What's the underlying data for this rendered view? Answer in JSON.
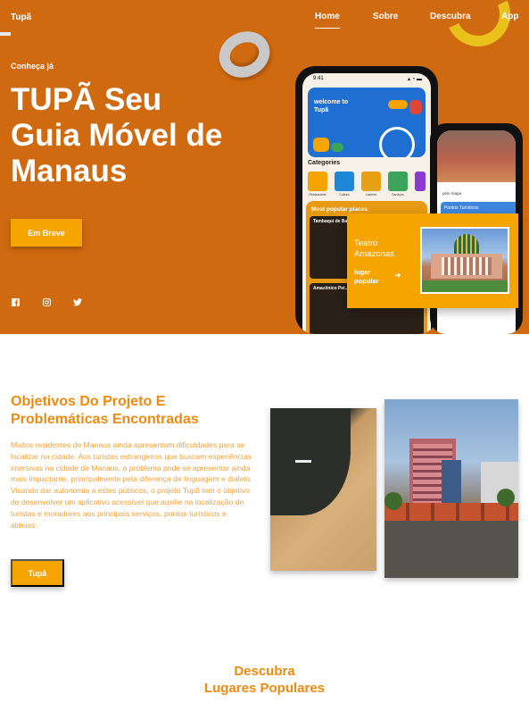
{
  "header": {
    "logo": "Tupã",
    "nav": [
      {
        "label": "Home",
        "active": true
      },
      {
        "label": "Sobre",
        "active": false
      },
      {
        "label": "Descubra",
        "active": false
      },
      {
        "label": "App",
        "active": false
      }
    ]
  },
  "hero": {
    "eyebrow": "Conheça já",
    "title_line1": "TUPÃ Seu",
    "title_line2_regular": "Guia Móvel ",
    "title_line2_bold": "de",
    "title_line3": "Manaus",
    "cta_label": "Em Breve",
    "social_icons": [
      "facebook-icon",
      "instagram-icon",
      "twitter-icon"
    ],
    "background_color": "#d06a10"
  },
  "phone_main": {
    "welcome": "welcome to\nTupã",
    "categories_title": "Categories",
    "categories": [
      "Restaurante",
      "Cultura",
      "Lazeres",
      "Serviços"
    ],
    "popular_title": "Most popular places",
    "places": [
      "Tambaqui de Ba...",
      "Amazônico Pei..."
    ]
  },
  "phone_secondary": {
    "label": "pelo mapa",
    "card_title": "Pontos Turísticos"
  },
  "teatro_card": {
    "title": "Teatro\nAmazonas",
    "subtitle": "lugar\npopular"
  },
  "objetivos": {
    "title": "Objetivos Do Projeto E Problemáticas Encontradas",
    "body": "Muitos residentes de Manaus ainda apresentam dificuldades para se localizar na cidade. Aos turistas estrangeiros que buscam experiências imersivas na cidade de Manaus, o problema pode se apresentar ainda mais impactante, principalmente pela diferença de linguagem e dialeto. Visando dar autonomia a estes públicos, o projeto Tupã tem o objetivo de desenvolver um aplicativo acessível que auxilie na localização de turistas e moradores aos principais serviços, pontos turísticos e aldeias.",
    "cta_label": "Tupã"
  },
  "descubra": {
    "line1": "Descubra",
    "line2": "Lugares Populares"
  },
  "colors": {
    "accent": "#f5a400",
    "heading_orange": "#ee8a0f"
  }
}
